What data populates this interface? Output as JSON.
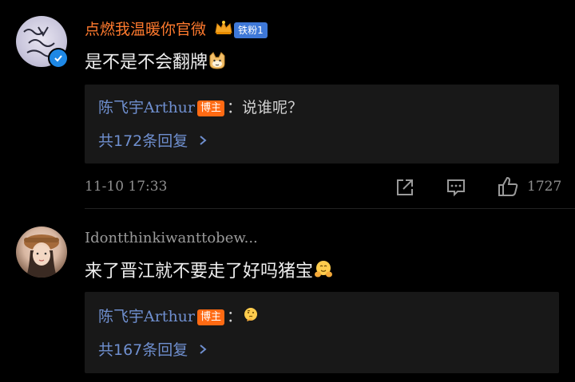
{
  "comments": [
    {
      "username": "点燃我温暖你官微",
      "fan_badge": "铁粉1",
      "text": "是不是不会翻牌",
      "text_emoji": "doge-emoji",
      "reply": {
        "blogger_name": "陈飞宇Arthur",
        "blogger_tag": "博主",
        "reply_text": "：说谁呢？",
        "reply_count_text": "共172条回复"
      },
      "time": "11-10 17:33",
      "like_count": "1727"
    },
    {
      "username": "Idontthinkiwanttobew...",
      "text": "来了晋江就不要走了好吗猪宝",
      "text_emoji": "hug-emoji",
      "reply": {
        "blogger_name": "陈飞宇Arthur",
        "blogger_tag": "博主",
        "reply_text": "：",
        "reply_emoji": "thinking-emoji",
        "reply_count_text": "共167条回复"
      }
    }
  ],
  "colors": {
    "background": "#000000",
    "username_orange": "#ff7a2e",
    "link_blue": "#6f8fcf",
    "blogger_tag_bg": "#ff6a13",
    "fan_badge_bg": "#3e78d8",
    "reply_box_bg": "#181818",
    "meta_gray": "#8f8f8f"
  }
}
